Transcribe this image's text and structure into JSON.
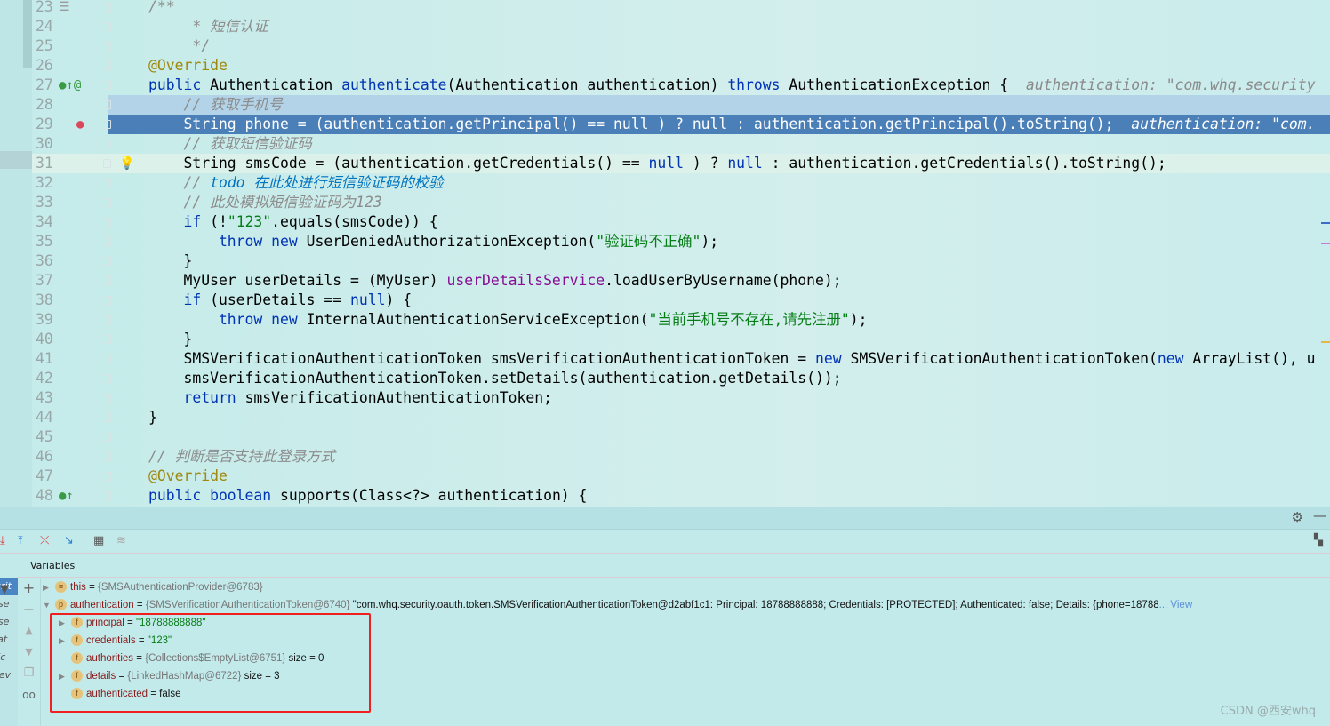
{
  "editor": {
    "lines": [
      {
        "num": "23",
        "tokens": [
          [
            "cm",
            "/**"
          ]
        ],
        "icon": "doc-icon"
      },
      {
        "num": "24",
        "tokens": [
          [
            "cm",
            "     * 短信认证"
          ]
        ]
      },
      {
        "num": "25",
        "tokens": [
          [
            "cm",
            "     */"
          ]
        ]
      },
      {
        "num": "26",
        "tokens": [
          [
            "an",
            "@Override"
          ]
        ]
      },
      {
        "num": "27",
        "tokens": [
          [
            "kw",
            "public "
          ],
          [
            "ty",
            "Authentication "
          ],
          [
            "kw",
            "authenticate"
          ],
          [
            "ty",
            "(Authentication authentication) "
          ],
          [
            "kw",
            "throws "
          ],
          [
            "ty",
            "AuthenticationException {  "
          ],
          [
            "hint",
            "authentication: \"com.whq.security"
          ]
        ],
        "icon": "implements-override-icon"
      },
      {
        "num": "28",
        "tokens": [
          [
            "cm",
            "    // 获取手机号"
          ]
        ],
        "state": "sel"
      },
      {
        "num": "29",
        "tokens": [
          [
            "ty",
            "    String phone = (authentication.getPrincipal() == null ) ? null : authentication.getPrincipal().toString();  "
          ],
          [
            "hint",
            "authentication: \"com."
          ]
        ],
        "state": "exec",
        "icon": "breakpoint-icon"
      },
      {
        "num": "30",
        "tokens": [
          [
            "cm",
            "    // 获取短信验证码"
          ]
        ]
      },
      {
        "num": "31",
        "tokens": [
          [
            "ty",
            "    String smsCode = (authentication.getCredentials() == "
          ],
          [
            "kw",
            "null"
          ],
          [
            "ty",
            " ) ? "
          ],
          [
            "kw",
            "null"
          ],
          [
            "ty",
            " : authentication.getCredentials().toString();"
          ]
        ],
        "state": "cur",
        "icon": "lightbulb-icon"
      },
      {
        "num": "32",
        "tokens": [
          [
            "cm",
            "    // "
          ],
          [
            "td",
            "todo 在此处进行短信验证码的校验"
          ]
        ]
      },
      {
        "num": "33",
        "tokens": [
          [
            "cm",
            "    // 此处模拟短信验证码为123"
          ]
        ]
      },
      {
        "num": "34",
        "tokens": [
          [
            "kw",
            "    if "
          ],
          [
            "ty",
            "(!"
          ],
          [
            "st",
            "\"123\""
          ],
          [
            "ty",
            ".equals(smsCode)) {"
          ]
        ]
      },
      {
        "num": "35",
        "tokens": [
          [
            "kw",
            "        throw new "
          ],
          [
            "ty",
            "UserDeniedAuthorizationException("
          ],
          [
            "st",
            "\"验证码不正确\""
          ],
          [
            "ty",
            ");"
          ]
        ]
      },
      {
        "num": "36",
        "tokens": [
          [
            "ty",
            "    }"
          ]
        ]
      },
      {
        "num": "37",
        "tokens": [
          [
            "ty",
            "    MyUser userDetails = (MyUser) "
          ],
          [
            "fd",
            "userDetailsService"
          ],
          [
            "ty",
            ".loadUserByUsername(phone);"
          ]
        ]
      },
      {
        "num": "38",
        "tokens": [
          [
            "kw",
            "    if "
          ],
          [
            "ty",
            "(userDetails == "
          ],
          [
            "kw",
            "null"
          ],
          [
            "ty",
            ") {"
          ]
        ]
      },
      {
        "num": "39",
        "tokens": [
          [
            "kw",
            "        throw new "
          ],
          [
            "ty",
            "InternalAuthenticationServiceException("
          ],
          [
            "st",
            "\"当前手机号不存在,请先注册\""
          ],
          [
            "ty",
            ");"
          ]
        ]
      },
      {
        "num": "40",
        "tokens": [
          [
            "ty",
            "    }"
          ]
        ]
      },
      {
        "num": "41",
        "tokens": [
          [
            "ty",
            "    SMSVerificationAuthenticationToken smsVerificationAuthenticationToken = "
          ],
          [
            "kw",
            "new "
          ],
          [
            "ty",
            "SMSVerificationAuthenticationToken("
          ],
          [
            "kw",
            "new "
          ],
          [
            "ty",
            "ArrayList(), u"
          ]
        ]
      },
      {
        "num": "42",
        "tokens": [
          [
            "ty",
            "    smsVerificationAuthenticationToken.setDetails(authentication.getDetails());"
          ]
        ]
      },
      {
        "num": "43",
        "tokens": [
          [
            "kw",
            "    return "
          ],
          [
            "ty",
            "smsVerificationAuthenticationToken;"
          ]
        ]
      },
      {
        "num": "44",
        "tokens": [
          [
            "ty",
            "}"
          ]
        ]
      },
      {
        "num": "45",
        "tokens": []
      },
      {
        "num": "46",
        "tokens": [
          [
            "cm",
            "// 判断是否支持此登录方式"
          ]
        ]
      },
      {
        "num": "47",
        "tokens": [
          [
            "an",
            "@Override"
          ]
        ]
      },
      {
        "num": "48",
        "tokens": [
          [
            "kw",
            "public boolean "
          ],
          [
            "ty",
            "supports(Class<?> authentication) {"
          ]
        ],
        "icon": "implements-icon"
      }
    ]
  },
  "debug": {
    "variables_label": "Variables",
    "frames": [
      "curit",
      "k.se",
      "k.se",
      "icat",
      "r (c",
      "mev"
    ],
    "vars": [
      {
        "name": "this",
        "eq": " = ",
        "type": "{SMSAuthenticationProvider@6783}",
        "badge": "≡",
        "expand": "▶",
        "indent": 0
      },
      {
        "name": "authentication",
        "eq": " = ",
        "type": "{SMSVerificationAuthenticationToken@6740}",
        "extra": " \"com.whq.security.oauth.token.SMSVerificationAuthenticationToken@d2abf1c1: Principal: 18788888888; Credentials: [PROTECTED]; Authenticated: false; Details: {phone=18788",
        "link": "... View",
        "badge": "p",
        "expand": "▼",
        "indent": 0
      },
      {
        "name": "principal",
        "eq": " = ",
        "str": "\"18788888888\"",
        "badge": "f",
        "expand": "▶",
        "indent": 1
      },
      {
        "name": "credentials",
        "eq": " = ",
        "str": "\"123\"",
        "badge": "f",
        "expand": "▶",
        "indent": 1
      },
      {
        "name": "authorities",
        "eq": " = ",
        "type": "{Collections$EmptyList@6751}",
        "extra": "  size = 0",
        "badge": "f",
        "expand": "",
        "indent": 1
      },
      {
        "name": "details",
        "eq": " = ",
        "type": "{LinkedHashMap@6722}",
        "extra": "  size = 3",
        "badge": "f",
        "expand": "▶",
        "indent": 1
      },
      {
        "name": "authenticated",
        "eq": " = ",
        "extra": "false",
        "badge": "f",
        "expand": "",
        "indent": 1
      }
    ]
  },
  "watermark": "CSDN @西安whq",
  "colors": {
    "highlight_box": "#f02020",
    "execution_line": "#4a7fb8"
  }
}
